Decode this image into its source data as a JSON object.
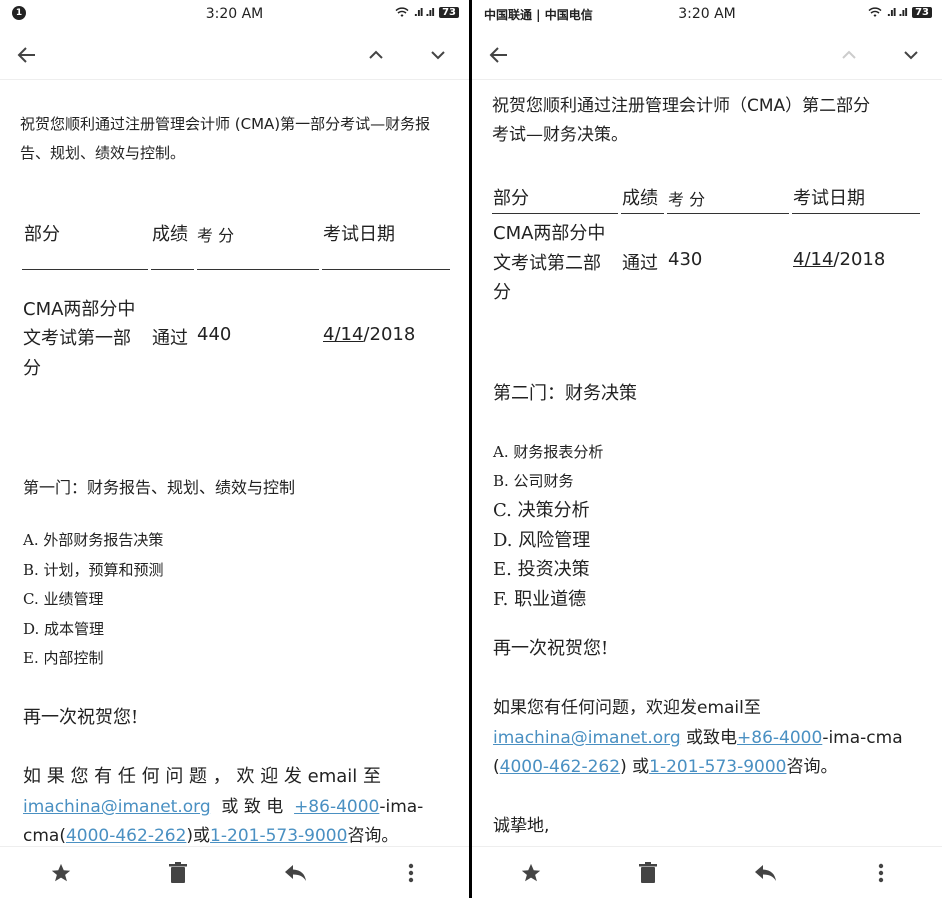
{
  "left": {
    "status": {
      "notif": "1",
      "time": "3:20 AM",
      "signal": ".ıl .ıl",
      "battery": "73"
    },
    "intro": "祝贺您顺利通过注册管理会计师 (CMA)第一部分考试—财务报告、规划、绩效与控制。",
    "table": {
      "headers": [
        "部分",
        "成绩",
        "考 分",
        "考试日期"
      ],
      "row": {
        "part_l1": "CMA两部分中",
        "part_l2": "文考试第一部",
        "part_l3": "分",
        "result": "通过",
        "score": "440",
        "date_m": "4/14",
        "date_y": "/2018"
      }
    },
    "section_title": "第一门：财务报告、规划、绩效与控制",
    "items": [
      "A. 外部财务报告决策",
      "B. 计划，预算和预测",
      "C. 业绩管理",
      "D. 成本管理",
      "E. 内部控制"
    ],
    "closing": "再一次祝贺您!",
    "contact": {
      "line1": "如 果 您 有 任 何 问 题 ， 欢 迎 发 email 至",
      "email": "imachina@imanet.org",
      "call_mid": "  或 致 电  ",
      "phone1": "+86-4000",
      "phone1_tail": "-ima-",
      "line3_head": "cma(",
      "phone2": "4000-462-262",
      "line3_mid": ")或",
      "phone3": "1-201-573-9000",
      "line3_tail": "咨询。"
    }
  },
  "right": {
    "status": {
      "carriers": "中国联通 | 中国电信",
      "time": "3:20 AM",
      "signal": ".ıl .ıl",
      "battery": "73"
    },
    "intro_l1": "祝贺您顺利通过注册管理会计师（CMA）第二部分",
    "intro_l2": "考试—财务决策。",
    "table": {
      "headers": [
        "部分",
        "成绩",
        "考 分",
        "考试日期"
      ],
      "row": {
        "part_l1": "CMA两部分中",
        "part_l2": "文考试第二部",
        "part_l3": "分",
        "result": "通过",
        "score": "430",
        "date_m": "4/14",
        "date_y": "/2018"
      }
    },
    "section_title": "第二门：财务决策",
    "items_small": [
      "A. 财务报表分析",
      "B. 公司财务"
    ],
    "items_big": [
      "C. 决策分析",
      "D. 风险管理",
      "E. 投资决策",
      "F. 职业道德"
    ],
    "closing": "再一次祝贺您!",
    "contact": {
      "line1": "如果您有任何问题，欢迎发email至",
      "email": "imachina@imanet.org",
      "call_mid": " 或致电",
      "phone1": "+86-4000",
      "phone1_tail": "-ima-cma",
      "line3_head": "(",
      "phone2": "4000-462-262",
      "line3_mid": ") 或",
      "phone3": "1-201-573-9000",
      "line3_tail": "咨询。"
    },
    "signoff": "诚挚地,"
  }
}
